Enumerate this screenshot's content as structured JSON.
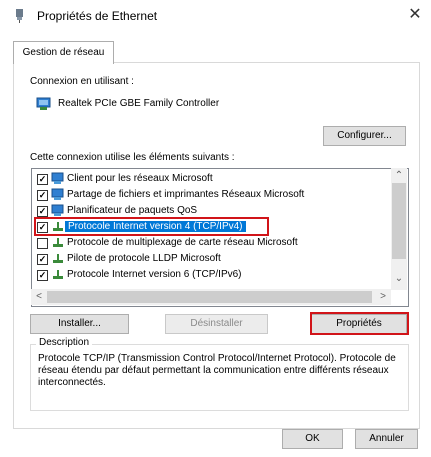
{
  "window": {
    "title": "Propriétés de Ethernet",
    "close_glyph": "✕"
  },
  "tabs": [
    {
      "label": "Gestion de réseau"
    }
  ],
  "connection": {
    "label": "Connexion en utilisant :",
    "adapter": "Realtek PCIe GBE Family Controller",
    "configure_label": "Configurer..."
  },
  "items": {
    "label": "Cette connexion utilise les éléments suivants :",
    "list": [
      {
        "label": "Client pour les réseaux Microsoft",
        "checked": true,
        "icon": "network-client-icon"
      },
      {
        "label": "Partage de fichiers et imprimantes Réseaux Microsoft",
        "checked": true,
        "icon": "network-service-icon"
      },
      {
        "label": "Planificateur de paquets QoS",
        "checked": true,
        "icon": "network-service-icon"
      },
      {
        "label": "Protocole Internet version 4 (TCP/IPv4)",
        "checked": true,
        "icon": "protocol-icon",
        "selected": true
      },
      {
        "label": "Protocole de multiplexage de carte réseau Microsoft",
        "checked": false,
        "icon": "protocol-icon"
      },
      {
        "label": "Pilote de protocole LLDP Microsoft",
        "checked": true,
        "icon": "protocol-icon"
      },
      {
        "label": "Protocole Internet version 6 (TCP/IPv6)",
        "checked": true,
        "icon": "protocol-icon"
      }
    ]
  },
  "buttons": {
    "install": "Installer...",
    "uninstall": "Désinstaller",
    "properties": "Propriétés",
    "ok": "OK",
    "cancel": "Annuler"
  },
  "description": {
    "legend": "Description",
    "text": "Protocole TCP/IP (Transmission Control Protocol/Internet Protocol). Protocole de réseau étendu par défaut permettant la communication entre différents réseaux interconnectés."
  },
  "colors": {
    "selection": "#0078d7",
    "highlight_box": "#d11419"
  }
}
